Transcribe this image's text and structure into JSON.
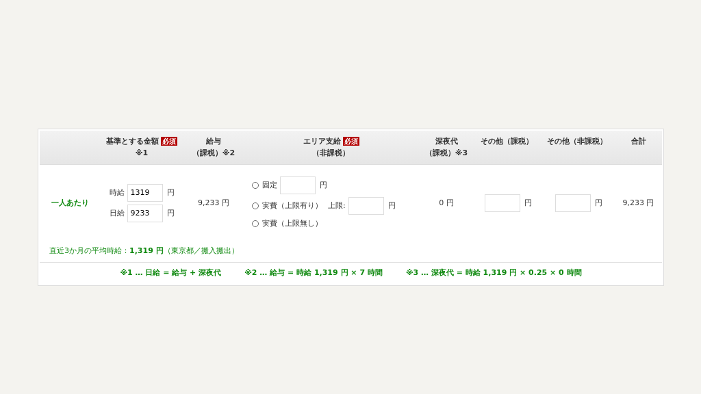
{
  "headers": [
    {
      "lines": [
        "基準とする金額",
        "※1"
      ],
      "required": true,
      "required_label": "必須"
    },
    {
      "lines": [
        "給与",
        "（課税）※2"
      ],
      "required": false
    },
    {
      "lines": [
        "エリア支給",
        "（非課税）"
      ],
      "required": true,
      "required_label": "必須"
    },
    {
      "lines": [
        "深夜代",
        "（課税）※3"
      ],
      "required": false
    },
    {
      "lines": [
        "その他（課税）"
      ],
      "required": false
    },
    {
      "lines": [
        "その他（非課税）"
      ],
      "required": false
    },
    {
      "lines": [
        "合計"
      ],
      "required": false
    }
  ],
  "row": {
    "label": "一人あたり",
    "base_fields": [
      {
        "label": "時給",
        "value": "1319",
        "unit": "円"
      },
      {
        "label": "日給",
        "value": "9233",
        "unit": "円"
      }
    ],
    "salary": "9,233 円",
    "area_options": [
      {
        "label": "固定",
        "selected": false,
        "amount_unit": "円"
      },
      {
        "label": "実費（上限有り）",
        "selected": false,
        "cap_label": "上限:",
        "amount_unit": "円"
      },
      {
        "label": "実費（上限無し）",
        "selected": false
      }
    ],
    "night": "0 円",
    "other_taxed_unit": "円",
    "other_nontaxed_unit": "円",
    "total": "9,233 円"
  },
  "note": "直近3か月の平均時給：**1,319 円**（東京都／搬入搬出）",
  "footnotes": [
    "※1 … 日給 = 給与 + 深夜代",
    "※2 … 給与 = 時給 1,319 円 × 7 時間",
    "※3 … 深夜代 = 時給 1,319 円 × 0.25 × 0 時間"
  ]
}
